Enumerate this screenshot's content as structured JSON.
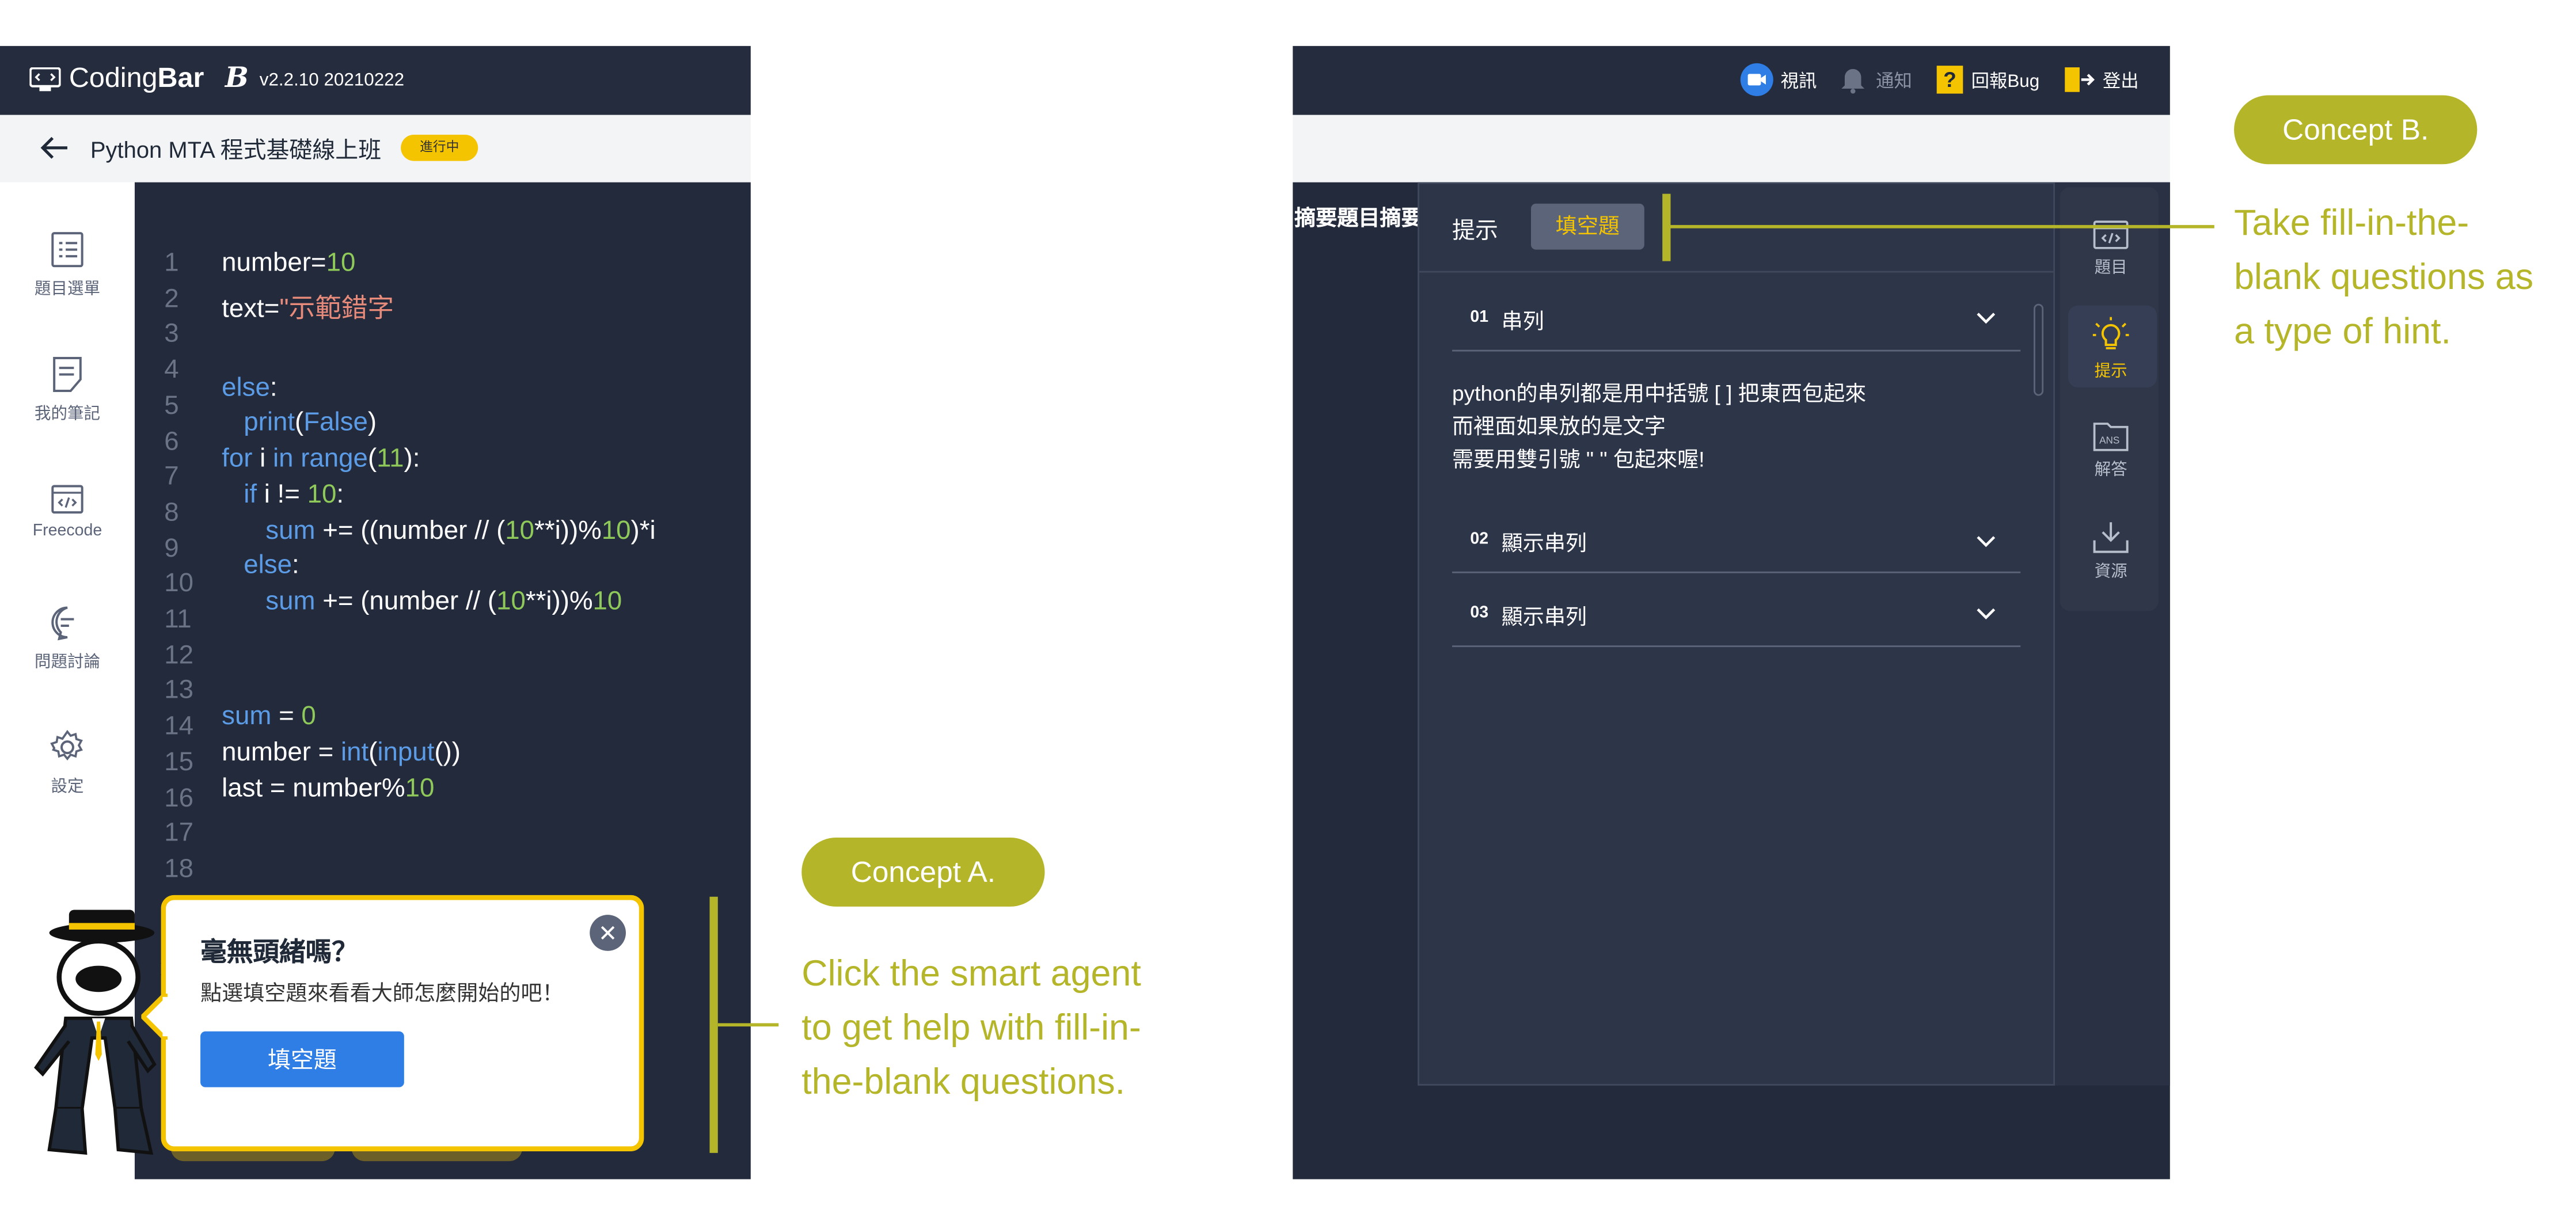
{
  "left_screen": {
    "app": {
      "logo_text_light": "Coding",
      "logo_text_bold": "Bar",
      "b_mark": "B",
      "version": "v2.2.10 20210222"
    },
    "course": {
      "title": "Python MTA 程式基礎線上班",
      "status": "進行中"
    },
    "sidebar": {
      "items": [
        {
          "label": "題目選單",
          "icon": "list-icon"
        },
        {
          "label": "我的筆記",
          "icon": "note-icon"
        },
        {
          "label": "Freecode",
          "icon": "code-window-icon"
        },
        {
          "label": "問題討論",
          "icon": "chat-icon"
        },
        {
          "label": "設定",
          "icon": "gear-icon"
        }
      ]
    },
    "editor": {
      "line_numbers": [
        "1",
        "2",
        "3",
        "4",
        "5",
        "6",
        "7",
        "8",
        "9",
        "10",
        "11",
        "12",
        "13",
        "14",
        "15",
        "16",
        "17",
        "18"
      ]
    },
    "agent_bubble": {
      "title": "毫無頭緒嗎？",
      "text": "點選填空題來看看大師怎麼開始的吧！",
      "button": "填空題"
    }
  },
  "right_screen": {
    "topbar": {
      "video": "視訊",
      "notify": "通知",
      "report": "回報Bug",
      "logout": "登出"
    },
    "summary_label": "摘要題目摘要",
    "hint_panel": {
      "title": "提示",
      "active_tab": "填空題",
      "accordion": [
        {
          "num": "01",
          "label": "串列",
          "expanded": true,
          "body": [
            "python的串列都是用中括號 [ ] 把東西包起來",
            "而裡面如果放的是文字",
            "需要用雙引號 \" \" 包起來喔!"
          ]
        },
        {
          "num": "02",
          "label": "顯示串列",
          "expanded": false
        },
        {
          "num": "03",
          "label": "顯示串列",
          "expanded": false
        }
      ]
    },
    "rail": [
      {
        "label": "題目",
        "icon": "code-icon"
      },
      {
        "label": "提示",
        "icon": "lightbulb-icon",
        "active": true
      },
      {
        "label": "解答",
        "icon": "ans-folder-icon"
      },
      {
        "label": "資源",
        "icon": "download-icon"
      }
    ]
  },
  "annotations": {
    "concept_a": {
      "label": "Concept A.",
      "lines": [
        "Click the smart agent",
        "to get help with fill-in-",
        "the-blank questions."
      ]
    },
    "concept_b": {
      "label": "Concept B.",
      "lines": [
        "Take fill-in-the-",
        "blank questions as",
        "a type of hint."
      ]
    }
  },
  "colors": {
    "accent_olive": "#b5b52a",
    "brand_yellow": "#f5c400",
    "editor_bg": "#222a3c",
    "button_blue": "#2f7ee6"
  }
}
